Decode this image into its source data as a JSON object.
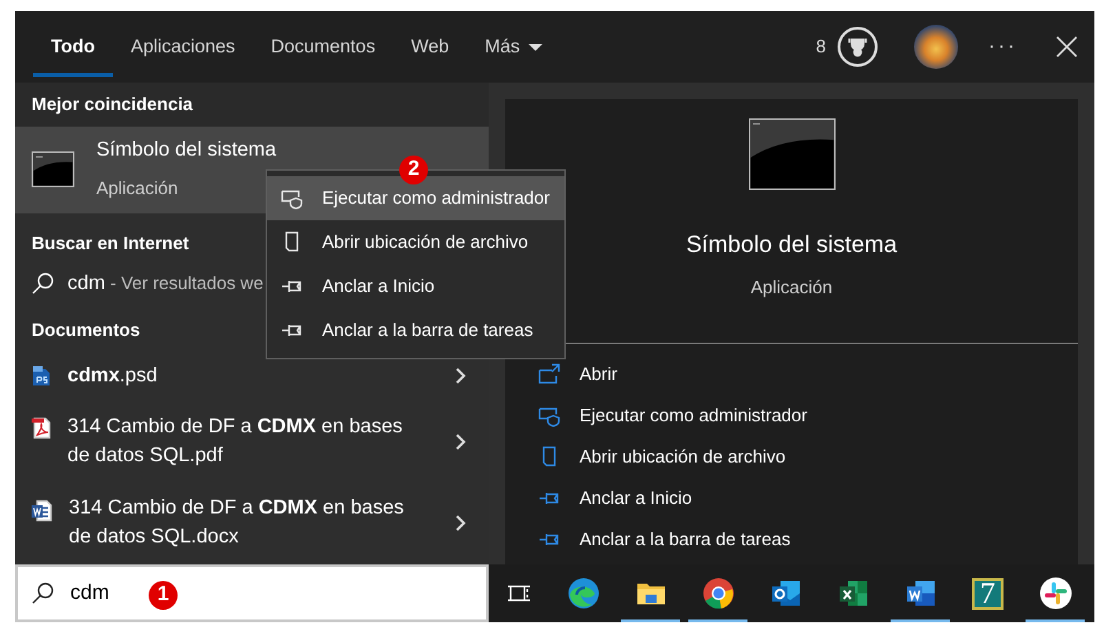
{
  "tabs": [
    {
      "label": "Todo",
      "selected": true,
      "kind": "plain"
    },
    {
      "label": "Aplicaciones",
      "selected": false,
      "kind": "plain"
    },
    {
      "label": "Documentos",
      "selected": false,
      "kind": "plain"
    },
    {
      "label": "Web",
      "selected": false,
      "kind": "plain"
    },
    {
      "label": "Más",
      "selected": false,
      "kind": "dropdown"
    }
  ],
  "header": {
    "reward_count": "8",
    "more": "···"
  },
  "best_match": {
    "heading": "Mejor coincidencia",
    "title": "Símbolo del sistema",
    "subtitle": "Aplicación",
    "selected": true
  },
  "web": {
    "heading": "Buscar en Internet",
    "query": "cdm",
    "hint": " - Ver resultados we"
  },
  "documents": {
    "heading": "Documentos",
    "items": [
      {
        "name": "**cdmx**.psd",
        "kind": "psd"
      },
      {
        "name": "314 Cambio de DF a **CDMX** en bases de datos SQL.pdf",
        "kind": "pdf"
      },
      {
        "name": "314 Cambio de DF a **CDMX** en bases de datos SQL.docx",
        "kind": "docx"
      }
    ]
  },
  "context_menu": [
    {
      "label": "Ejecutar como administrador",
      "kind": "admin",
      "selected": true
    },
    {
      "label": "Abrir ubicación de archivo",
      "kind": "folder",
      "selected": false
    },
    {
      "label": "Anclar a Inicio",
      "kind": "pin",
      "selected": false
    },
    {
      "label": "Anclar a la barra de tareas",
      "kind": "pin",
      "selected": false
    }
  ],
  "preview": {
    "title": "Símbolo del sistema",
    "subtitle": "Aplicación",
    "actions": [
      {
        "label": "Abrir",
        "kind": "open"
      },
      {
        "label": "Ejecutar como administrador",
        "kind": "admin"
      },
      {
        "label": "Abrir ubicación de archivo",
        "kind": "folder"
      },
      {
        "label": "Anclar a Inicio",
        "kind": "pin"
      },
      {
        "label": "Anclar a la barra de tareas",
        "kind": "pin"
      }
    ]
  },
  "search_box": {
    "value": "cdm"
  },
  "taskbar": [
    {
      "kind": "taskview",
      "running": false
    },
    {
      "kind": "edge",
      "running": false
    },
    {
      "kind": "explorer",
      "running": true
    },
    {
      "kind": "chrome",
      "running": true
    },
    {
      "kind": "outlook",
      "running": false
    },
    {
      "kind": "excel",
      "running": false
    },
    {
      "kind": "word",
      "running": true
    },
    {
      "kind": "seven",
      "label": "7",
      "running": false
    },
    {
      "kind": "slack",
      "running": true
    }
  ],
  "callouts": [
    "1",
    "2"
  ]
}
